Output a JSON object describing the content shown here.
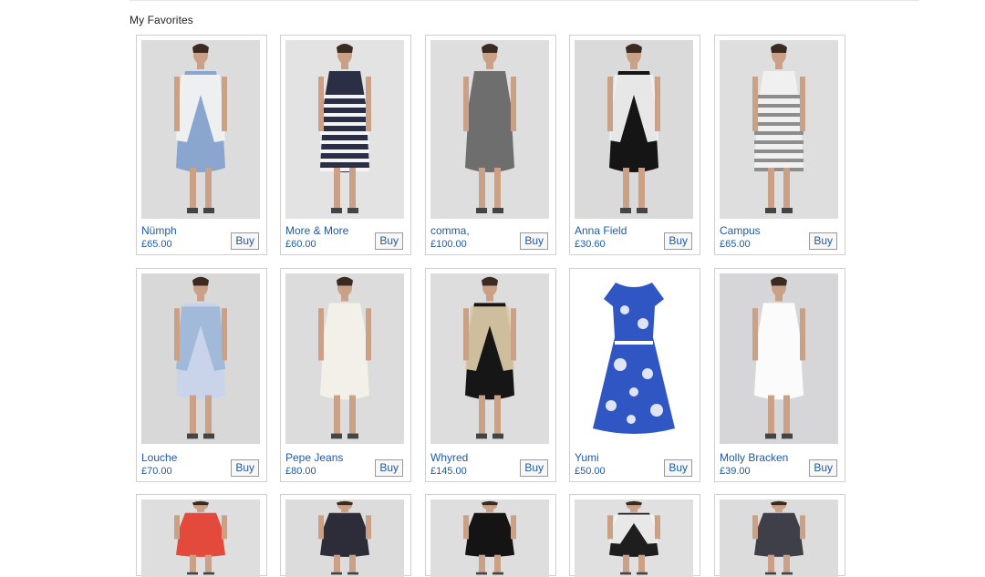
{
  "section": {
    "title": "My Favorites"
  },
  "buy_label": "Buy",
  "colors": {
    "link": "#1f5aa6",
    "border": "#cfcfcf",
    "button_border": "#9a9a9a"
  },
  "products": [
    {
      "brand": "Nümph",
      "price": "£65.00",
      "image": "woman-white-jacket-blue-print-dress-photo"
    },
    {
      "brand": "More & More",
      "price": "£60.00",
      "image": "woman-striped-dress-photo"
    },
    {
      "brand": "comma,",
      "price": "£100.00",
      "image": "woman-grey-dress-photo"
    },
    {
      "brand": "Anna Field",
      "price": "£30.60",
      "image": "woman-black-dress-white-jacket-photo"
    },
    {
      "brand": "Campus",
      "price": "£65.00",
      "image": "woman-white-striped-dress-photo"
    },
    {
      "brand": "Louche",
      "price": "£70.00",
      "image": "woman-denim-jacket-floral-dress-photo"
    },
    {
      "brand": "Pepe Jeans",
      "price": "£80.00",
      "image": "woman-white-dress-brown-bag-photo"
    },
    {
      "brand": "Whyred",
      "price": "£145.00",
      "image": "woman-beige-coat-black-dress-photo"
    },
    {
      "brand": "Yumi",
      "price": "£50.00",
      "image": "blue-floral-dress-product-photo"
    },
    {
      "brand": "Molly Bracken",
      "price": "£39.00",
      "image": "woman-white-slip-dress-photo"
    },
    {
      "image": "woman-red-top-photo"
    },
    {
      "image": "woman-dark-top-red-sleeves-photo"
    },
    {
      "image": "woman-black-top-photo"
    },
    {
      "image": "woman-white-jacket-patterned-dress-photo"
    },
    {
      "image": "woman-patterned-strapless-dress-photo"
    }
  ]
}
